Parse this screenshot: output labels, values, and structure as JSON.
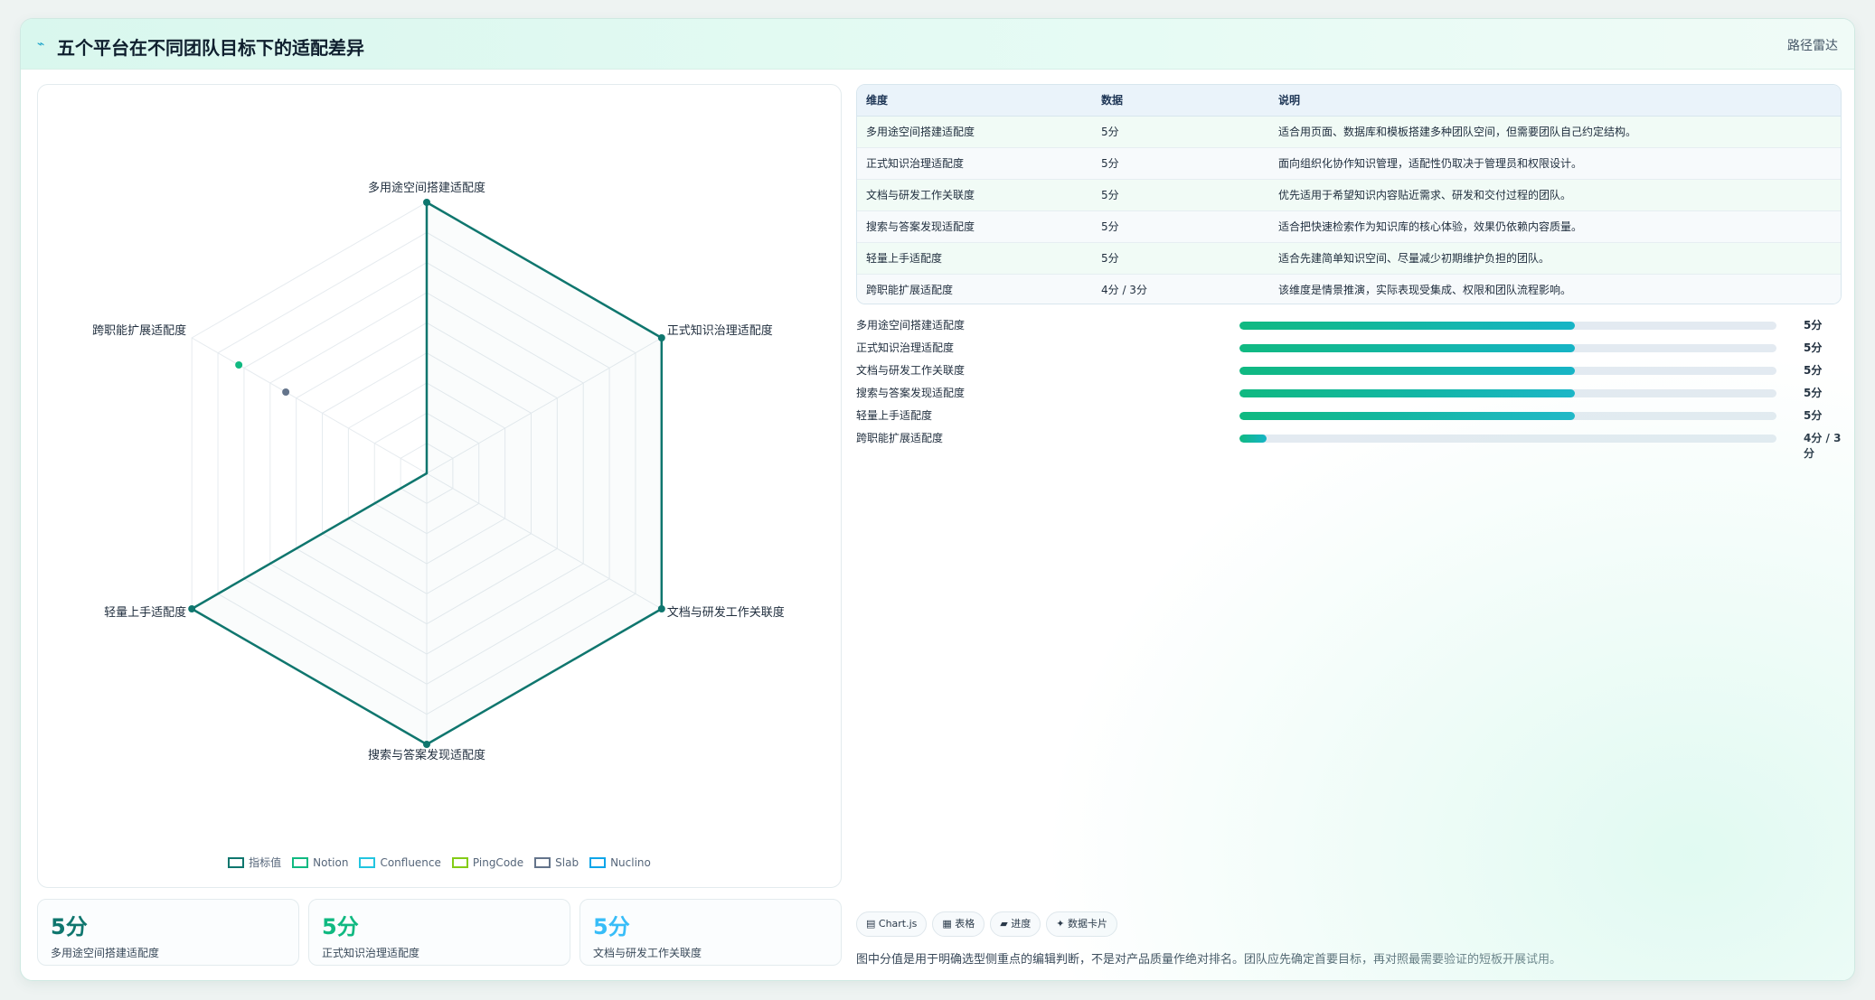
{
  "header": {
    "icon": "trend-line-icon",
    "title": "五个平台在不同团队目标下的适配差异",
    "tag": "路径雷达"
  },
  "colors": {
    "primary": "#0f766e",
    "notion": "#10b981",
    "confluence": "#22c5e0",
    "pingcode": "#84cc16",
    "slab": "#64748b",
    "nuclino": "#0ea5e9"
  },
  "chart_data": {
    "type": "radar",
    "axes": [
      "多用途空间搭建适配度",
      "正式知识治理适配度",
      "文档与研发工作关联度",
      "搜索与答案发现适配度",
      "轻量上手适配度",
      "跨职能扩展适配度"
    ],
    "range": [
      0,
      5
    ],
    "grid": true,
    "legend_position": "bottom",
    "series": [
      {
        "name": "指标值",
        "values": [
          5,
          5,
          5,
          5,
          5,
          0
        ]
      },
      {
        "name": "Notion",
        "values": [
          null,
          null,
          null,
          null,
          null,
          4
        ]
      },
      {
        "name": "Confluence",
        "values": [
          null,
          null,
          null,
          null,
          null,
          null
        ]
      },
      {
        "name": "PingCode",
        "values": [
          null,
          null,
          null,
          null,
          null,
          null
        ]
      },
      {
        "name": "Slab",
        "values": [
          null,
          null,
          null,
          null,
          null,
          3
        ]
      },
      {
        "name": "Nuclino",
        "values": [
          null,
          null,
          null,
          null,
          null,
          null
        ]
      }
    ]
  },
  "table": {
    "headers": [
      "维度",
      "数据",
      "说明"
    ],
    "rows": [
      [
        "多用途空间搭建适配度",
        "5分",
        "适合用页面、数据库和模板搭建多种团队空间，但需要团队自己约定结构。"
      ],
      [
        "正式知识治理适配度",
        "5分",
        "面向组织化协作知识管理，适配性仍取决于管理员和权限设计。"
      ],
      [
        "文档与研发工作关联度",
        "5分",
        "优先适用于希望知识内容贴近需求、研发和交付过程的团队。"
      ],
      [
        "搜索与答案发现适配度",
        "5分",
        "适合把快速检索作为知识库的核心体验，效果仍依赖内容质量。"
      ],
      [
        "轻量上手适配度",
        "5分",
        "适合先建简单知识空间、尽量减少初期维护负担的团队。"
      ],
      [
        "跨职能扩展适配度",
        "4分 / 3分",
        "该维度是情景推演，实际表现受集成、权限和团队流程影响。"
      ]
    ]
  },
  "bars": [
    {
      "label": "多用途空间搭建适配度",
      "value": "5分",
      "fraction": 0.625
    },
    {
      "label": "正式知识治理适配度",
      "value": "5分",
      "fraction": 0.625
    },
    {
      "label": "文档与研发工作关联度",
      "value": "5分",
      "fraction": 0.625
    },
    {
      "label": "搜索与答案发现适配度",
      "value": "5分",
      "fraction": 0.625
    },
    {
      "label": "轻量上手适配度",
      "value": "5分",
      "fraction": 0.625
    },
    {
      "label": "跨职能扩展适配度",
      "value": "4分 / 3分",
      "fraction": 0.05
    }
  ],
  "stat_cards": [
    {
      "value": "5分",
      "label": "多用途空间搭建适配度",
      "color": "#0f766e"
    },
    {
      "value": "5分",
      "label": "正式知识治理适配度",
      "color": "#10b981"
    },
    {
      "value": "5分",
      "label": "文档与研发工作关联度",
      "color": "#38bdf8"
    }
  ],
  "chips": [
    "▤ Chart.js",
    "▦ 表格",
    "▰ 进度",
    "✦ 数据卡片"
  ],
  "footnote": "图中分值是用于明确选型侧重点的编辑判断，不是对产品质量作绝对排名。团队应先确定首要目标，再对照最需要验证的短板开展试用。"
}
